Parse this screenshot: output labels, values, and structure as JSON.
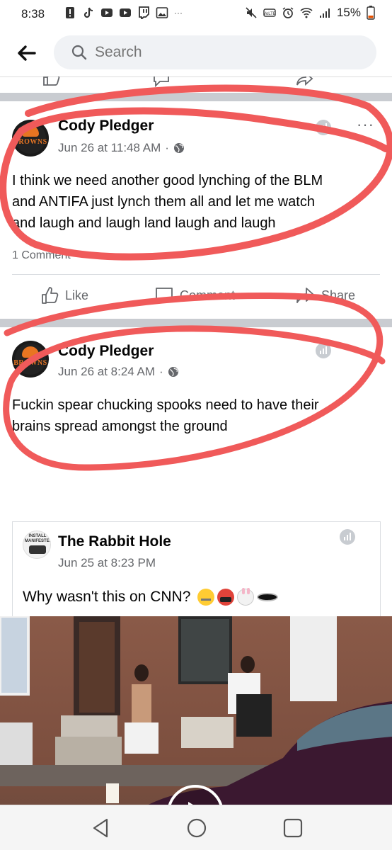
{
  "status_bar": {
    "time": "8:38",
    "battery": "15%"
  },
  "header": {
    "search_placeholder": "Search"
  },
  "post1": {
    "author": "Cody Pledger",
    "timestamp": "Jun 26 at 11:48 AM",
    "avatar_label": "BROWNS",
    "text_lines": [
      "I think we need another good lynching of the BLM",
      "and ANTIFA just lynch them all and let me watch",
      "and laugh and laugh land laugh and laugh"
    ],
    "comment_count": "1 Comment",
    "actions": {
      "like": "Like",
      "comment": "Comment",
      "share": "Share"
    }
  },
  "post2": {
    "author": "Cody Pledger",
    "timestamp": "Jun 26 at 8:24 AM",
    "avatar_label": "BROWNS",
    "text_lines": [
      "Fuckin spear chucking spooks need to have their",
      "brains spread amongst the ground"
    ],
    "shared": {
      "page_name": "The Rabbit Hole",
      "timestamp": "Jun 25 at 8:23 PM",
      "avatar_label": "INSTALL MANIFESTED",
      "text": "Why wasn't this on CNN?",
      "emojis": [
        "zipper-mouth-face",
        "cursing-face",
        "rabbit-face",
        "hole"
      ]
    }
  },
  "colors": {
    "annotation": "#f05a5a",
    "secondary_text": "#65676b",
    "divider": "#c9ccd1"
  }
}
